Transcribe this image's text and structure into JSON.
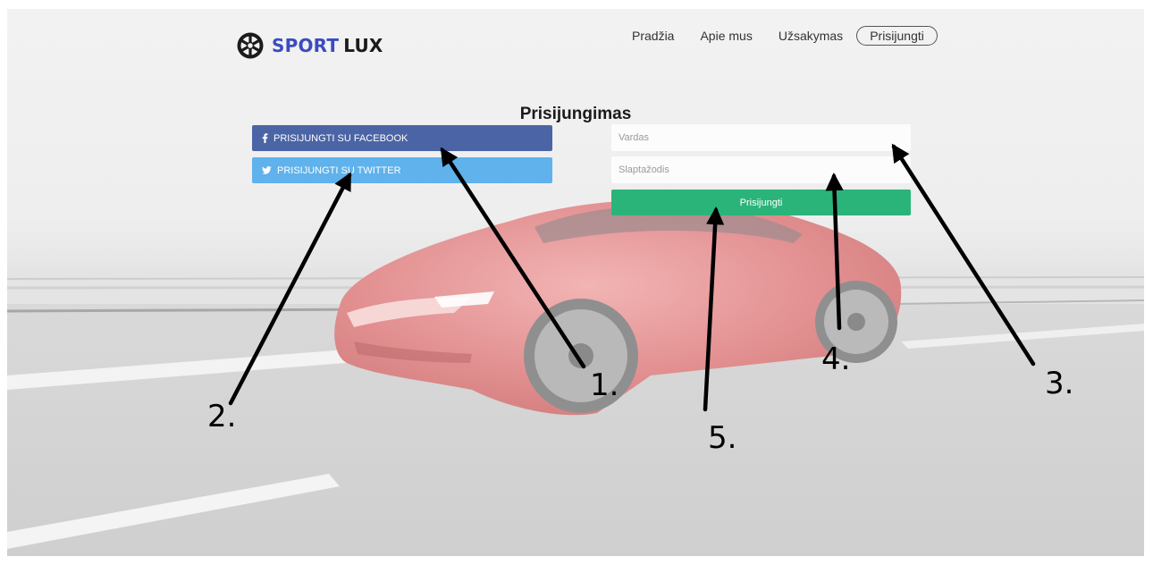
{
  "brand": {
    "word1": "SPORT",
    "word2": "LUX",
    "icon": "wheel-icon",
    "colors": {
      "sport": "#3b4cc0",
      "lux": "#1b1b1b"
    }
  },
  "nav": {
    "items": [
      "Pradžia",
      "Apie mus",
      "Užsakymas"
    ],
    "login": "Prisijungti"
  },
  "page": {
    "title": "Prisijungimas"
  },
  "social": {
    "facebook": {
      "label": "PRISIJUNGTI SU FACEBOOK",
      "icon": "facebook-icon",
      "color": "#4b64a5"
    },
    "twitter": {
      "label": "PRISIJUNGTI SU TWITTER",
      "icon": "twitter-icon",
      "color": "#5fb2ec"
    }
  },
  "form": {
    "username": {
      "placeholder": "Vardas",
      "value": ""
    },
    "password": {
      "placeholder": "Slaptažodis",
      "value": ""
    },
    "submit": {
      "label": "Prisijungti",
      "color": "#2bb47a"
    }
  },
  "annotations": [
    "1.",
    "2.",
    "3.",
    "4.",
    "5."
  ]
}
